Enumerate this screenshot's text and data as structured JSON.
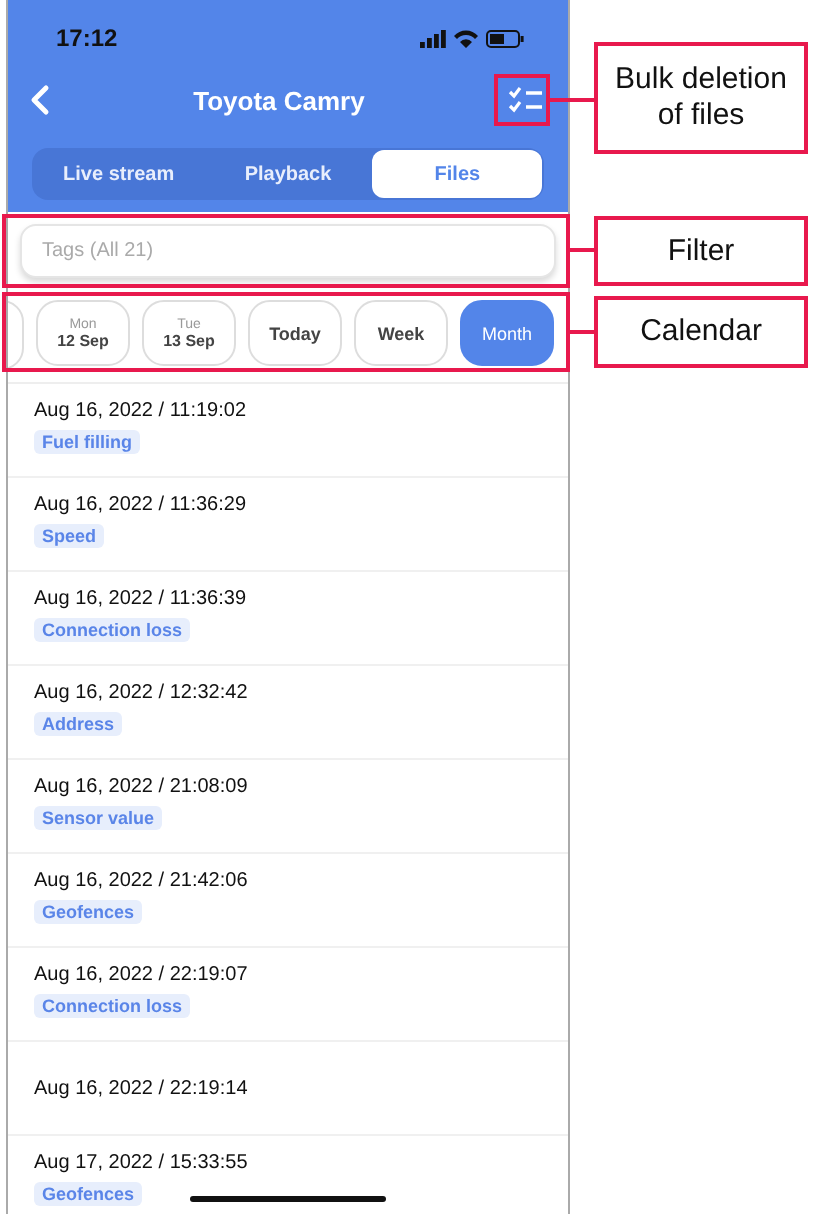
{
  "status_bar": {
    "time": "17:12"
  },
  "header": {
    "title": "Toyota Camry"
  },
  "tabs": [
    {
      "label": "Live stream",
      "selected": false
    },
    {
      "label": "Playback",
      "selected": false
    },
    {
      "label": "Files",
      "selected": true
    }
  ],
  "filter": {
    "placeholder": "Tags (All 21)"
  },
  "calendar": [
    {
      "kind": "day",
      "weekday": "Mon",
      "date": "12 Sep",
      "selected": false
    },
    {
      "kind": "day",
      "weekday": "Tue",
      "date": "13 Sep",
      "selected": false
    },
    {
      "kind": "range",
      "label": "Today",
      "selected": false
    },
    {
      "kind": "range",
      "label": "Week",
      "selected": false
    },
    {
      "kind": "range",
      "label": "Month",
      "selected": true
    }
  ],
  "files": [
    {
      "time": "Aug 16, 2022 / 11:19:02",
      "tag": "Fuel filling"
    },
    {
      "time": "Aug 16, 2022 / 11:36:29",
      "tag": "Speed"
    },
    {
      "time": "Aug 16, 2022 / 11:36:39",
      "tag": "Connection loss"
    },
    {
      "time": "Aug 16, 2022 / 12:32:42",
      "tag": "Address"
    },
    {
      "time": "Aug 16, 2022 / 21:08:09",
      "tag": "Sensor value"
    },
    {
      "time": "Aug 16, 2022 / 21:42:06",
      "tag": "Geofences"
    },
    {
      "time": "Aug 16, 2022 / 22:19:07",
      "tag": "Connection loss"
    },
    {
      "time": "Aug 16, 2022 / 22:19:14"
    },
    {
      "time": "Aug 17, 2022 / 15:33:55",
      "tag": "Geofences"
    }
  ],
  "annotations": [
    {
      "kind": "bulk",
      "text": "Bulk deletion of files"
    },
    {
      "kind": "filter",
      "text": "Filter"
    },
    {
      "kind": "calendar",
      "text": "Calendar"
    }
  ]
}
